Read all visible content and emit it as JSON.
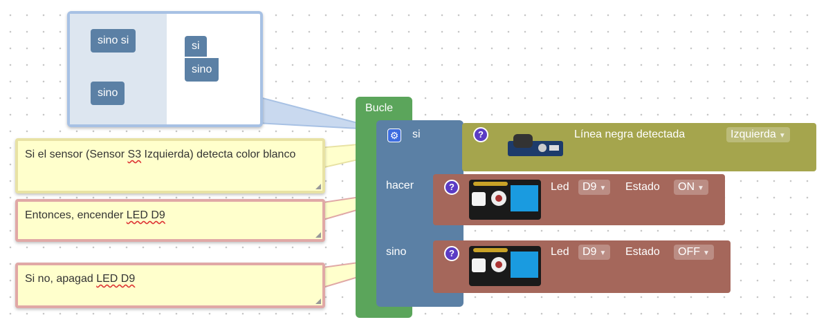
{
  "mutator": {
    "else_if_label": "sino si",
    "else_label": "sino",
    "if_label": "si",
    "if_else_label": "sino"
  },
  "loop_block": {
    "label": "Bucle"
  },
  "if_block": {
    "if_label": "si",
    "do_label": "hacer",
    "else_label": "sino"
  },
  "sensor_block": {
    "label": "Línea negra detectada",
    "side_value": "Izquierda"
  },
  "led_on_block": {
    "led_label": "Led",
    "pin_value": "D9",
    "state_label": "Estado",
    "state_value": "ON"
  },
  "led_off_block": {
    "led_label": "Led",
    "pin_value": "D9",
    "state_label": "Estado",
    "state_value": "OFF"
  },
  "comments": {
    "sensor_comment_a": "Si el sensor (Sensor ",
    "sensor_comment_b": "S3",
    "sensor_comment_c": " Izquierda) detecta color blanco",
    "led_on_comment_a": "Entonces, encender ",
    "led_on_comment_b": "LED D9",
    "led_off_comment_a": "Si no, apagad ",
    "led_off_comment_b": "LED D9"
  },
  "colors": {
    "loop_green": "#5ba55b",
    "logic_blue": "#5b80a5",
    "sensor_olive": "#a5a54d",
    "led_brown": "#a5675b",
    "comment_bg": "#ffffcc"
  }
}
